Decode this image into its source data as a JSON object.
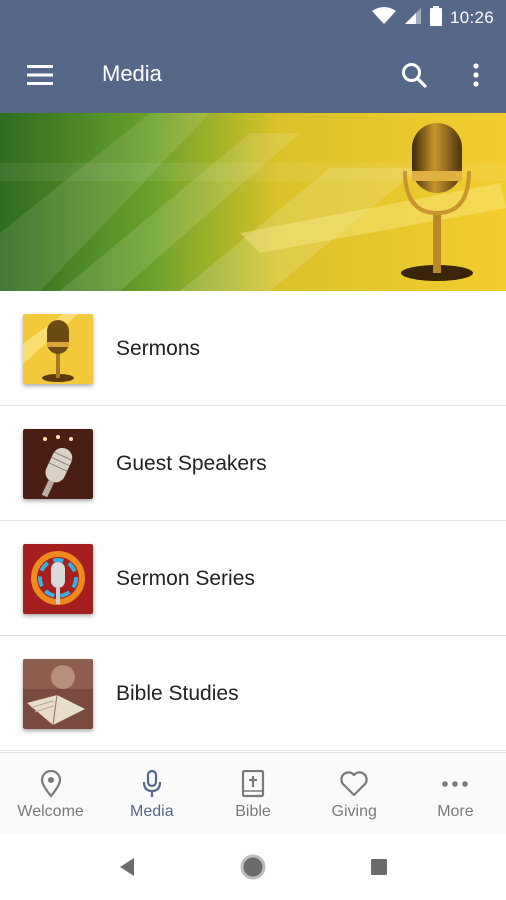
{
  "status_bar": {
    "time": "10:26",
    "icons": [
      "wifi-icon",
      "signal-icon",
      "battery-icon"
    ]
  },
  "app_bar": {
    "title": "Media",
    "icons": [
      "hamburger-menu-icon",
      "search-icon",
      "overflow-menu-icon"
    ],
    "background_color": "#56688a"
  },
  "banner": {
    "image": "microphone-banner"
  },
  "media_list": {
    "items": [
      {
        "label": "Sermons",
        "thumbnail": "golden-microphone-thumbnail"
      },
      {
        "label": "Guest Speakers",
        "thumbnail": "vintage-microphone-thumbnail"
      },
      {
        "label": "Sermon Series",
        "thumbnail": "microphone-splash-thumbnail"
      },
      {
        "label": "Bible Studies",
        "thumbnail": "open-bible-thumbnail"
      }
    ]
  },
  "bottom_nav": {
    "active": "Media",
    "active_color": "#56688a",
    "items": [
      {
        "label": "Welcome",
        "icon": "location-pin-icon"
      },
      {
        "label": "Media",
        "icon": "microphone-icon"
      },
      {
        "label": "Bible",
        "icon": "bible-book-icon"
      },
      {
        "label": "Giving",
        "icon": "heart-icon"
      },
      {
        "label": "More",
        "icon": "more-dots-icon"
      }
    ]
  },
  "system_nav": {
    "icons": [
      "back-triangle-icon",
      "home-circle-icon",
      "recents-square-icon"
    ]
  }
}
